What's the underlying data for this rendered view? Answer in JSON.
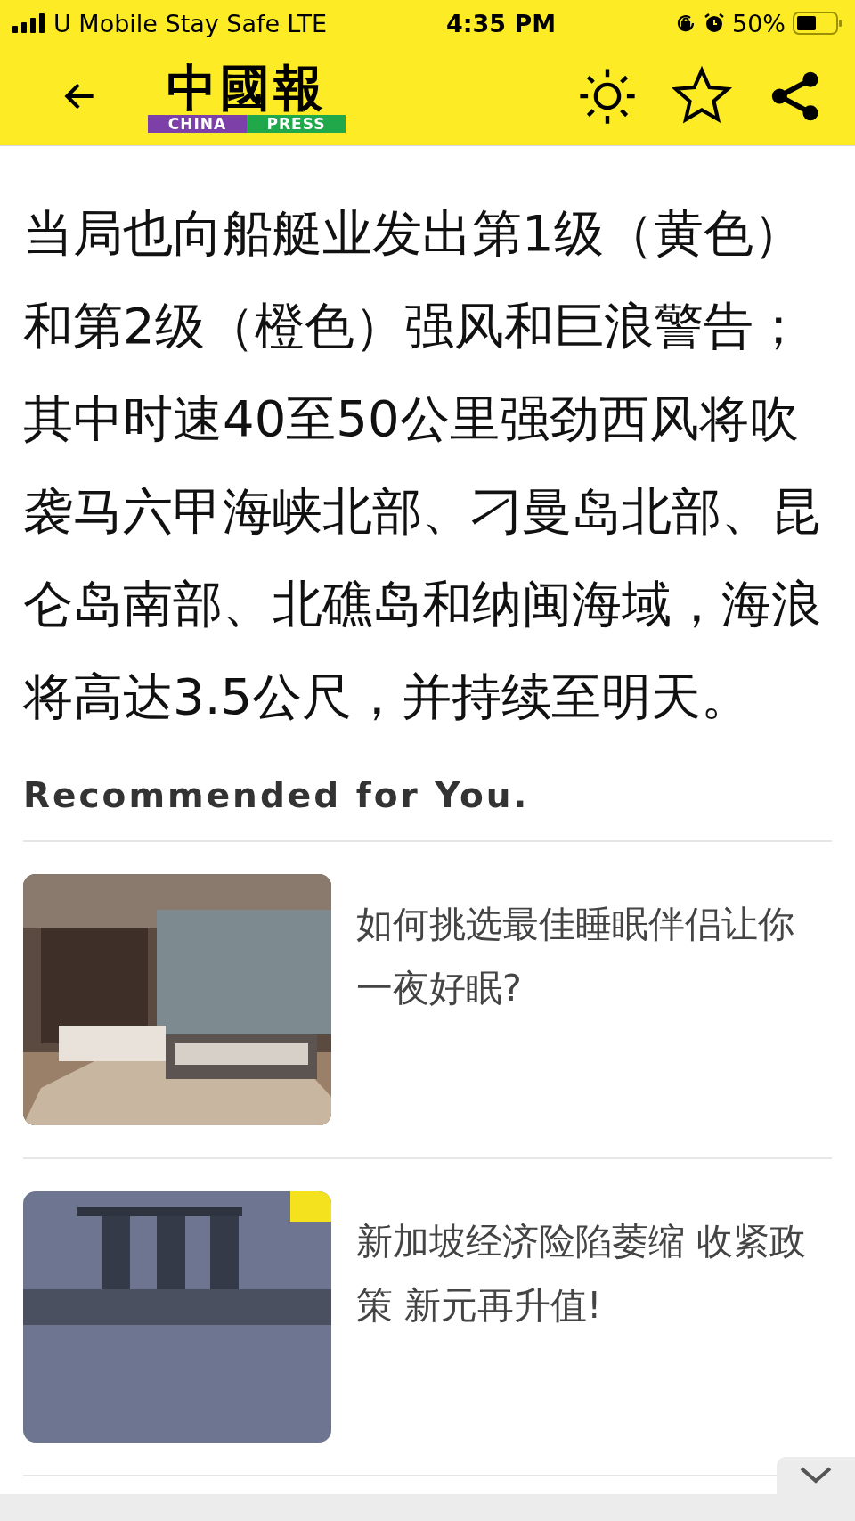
{
  "status_bar": {
    "carrier": "U Mobile Stay Safe",
    "network": "LTE",
    "time": "4:35 PM",
    "battery": "50%"
  },
  "header": {
    "logo": {
      "title": "中國報",
      "sub_left": "CHINA",
      "sub_right": "PRESS"
    }
  },
  "article": {
    "text": "当局也向船艇业发出第1级（黄色）和第2级（橙色）强风和巨浪警告；其中时速40至50公里强劲西风将吹袭马六甲海峡北部、刁曼岛北部、昆仑岛南部、北礁岛和纳闽海域，海浪将高达3.5公尺，并持续至明天。"
  },
  "recommended": {
    "heading": "Recommended for You.",
    "items": [
      {
        "title": "如何挑选最佳睡眠伴侣让你一夜好眠?",
        "kind": "bedroom"
      },
      {
        "title": "新加坡经济险陷萎缩 收紧政策 新元再升值!",
        "kind": "skyline"
      }
    ]
  }
}
